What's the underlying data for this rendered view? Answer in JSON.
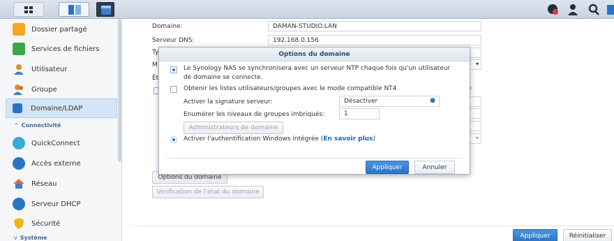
{
  "sidebar": {
    "items": [
      {
        "label": "Dossier partagé",
        "icon": "shared-folder-icon",
        "color": "#f5a623"
      },
      {
        "label": "Services de fichiers",
        "icon": "file-services-icon",
        "color": "#3ca64a"
      },
      {
        "label": "Utilisateur",
        "icon": "user-icon",
        "color": "#e58b2a"
      },
      {
        "label": "Groupe",
        "icon": "group-icon",
        "color": "#e58b2a"
      },
      {
        "label": "Domaine/LDAP",
        "icon": "domain-ldap-icon",
        "color": "#2a74c6"
      },
      {
        "label": "QuickConnect",
        "icon": "quickconnect-icon",
        "color": "#3aa9d6"
      },
      {
        "label": "Accès externe",
        "icon": "external-access-icon",
        "color": "#2a74c6"
      },
      {
        "label": "Réseau",
        "icon": "network-icon",
        "color": "#e06a34"
      },
      {
        "label": "Serveur DHCP",
        "icon": "dhcp-server-icon",
        "color": "#2a74c6"
      },
      {
        "label": "Sécurité",
        "icon": "security-icon",
        "color": "#f2b515"
      }
    ],
    "section_connectivity": "Connectivité",
    "section_system": "Système"
  },
  "form": {
    "domain_label": "Domaine:",
    "domain_value": "DAMAN-STUDIO.LAN",
    "dns_label": "Serveur DNS:",
    "dns_value": "192.168.0.156",
    "partial_label_1": "Ty",
    "partial_label_2": "M",
    "partial_label_3": "Ét",
    "domain_options_button": "Options du domaine",
    "domain_check_button": "Vérification de l'état du domaine"
  },
  "dialog": {
    "title": "Options du domaine",
    "ntp_sync_text": "Le Synology NAS se synchronisera avec un serveur NTP chaque fois qu'un utilisateur de domaine se connecte.",
    "nt4_text": "Obtenir les listes utilisateurs/groupes avec le mode compatible NT4",
    "signature_label": "Activer la signature serveur:",
    "signature_value": "Désactiver",
    "nested_label": "Enumérer les niveaux de groupes imbriqués:",
    "nested_value": "1",
    "admins_button": "Administrateurs de domaine",
    "windows_auth_text": "Activer l'authentification Windows intégrée (",
    "windows_auth_link": "En savoir plus",
    "windows_auth_close": ")",
    "apply_button": "Appliquer",
    "cancel_button": "Annuler"
  },
  "footer": {
    "apply_button": "Appliquer",
    "reset_button": "Réinitialiser"
  }
}
